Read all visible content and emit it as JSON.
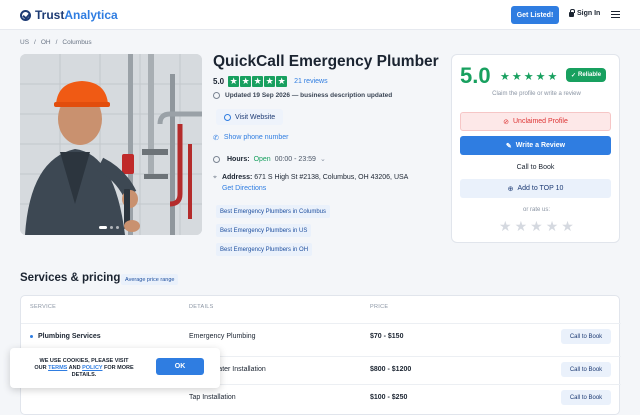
{
  "header": {
    "logo_part1": "Trust",
    "logo_part2": "Analytica",
    "get_listed": "Get Listed!",
    "sign_in": "Sign In"
  },
  "breadcrumb": [
    "US",
    "OH",
    "Columbus"
  ],
  "business": {
    "name": "QuickCall Emergency Plumber",
    "rating": "5.0",
    "stars": "★★★★★",
    "reviews": "21 reviews",
    "updated": "Updated 19 Sep 2026 — business description updated",
    "visit_website": "Visit Website",
    "show_phone": "Show phone number",
    "hours_label": "Hours:",
    "hours_status": "Open",
    "hours_time": "00:00 - 23:59",
    "address_label": "Address:",
    "address": "671 S High St #2138, Columbus, OH 43206, USA",
    "directions": "Get Directions",
    "tags": [
      "Best Emergency Plumbers in Columbus",
      "Best Emergency Plumbers in US",
      "Best Emergency Plumbers in OH"
    ]
  },
  "sidecard": {
    "score": "5.0",
    "reliable": "Reliable",
    "claim_text": "Claim the profile or write a review",
    "unclaimed": "Unclaimed Profile",
    "write_review": "Write a Review",
    "call_to_book": "Call to Book",
    "add_top10": "Add to TOP 10",
    "or_rate": "or rate us:"
  },
  "services": {
    "heading": "Services & pricing",
    "badge": "Average price range",
    "columns": [
      "SERVICE",
      "DETAILS",
      "PRICE"
    ],
    "rows": [
      {
        "service": "Plumbing Services",
        "detail": "Emergency Plumbing",
        "price": "$70 - $150",
        "action": "Call to Book"
      },
      {
        "service": "",
        "detail": "Water Heater Installation",
        "price": "$800 - $1200",
        "action": "Call to Book"
      },
      {
        "service": "",
        "detail": "Tap Installation",
        "price": "$100 - $250",
        "action": "Call to Book"
      }
    ]
  },
  "cookie": {
    "line1": "WE USE COOKIES, PLEASE VISIT",
    "our": "OUR",
    "terms": "TERMS",
    "and": "AND",
    "policy": "POLICY",
    "rest": "FOR MORE DETAILS.",
    "ok": "OK"
  },
  "colors": {
    "accent": "#2f7de1",
    "rating_green": "#18a05f",
    "brand_navy": "#1d3b74"
  }
}
